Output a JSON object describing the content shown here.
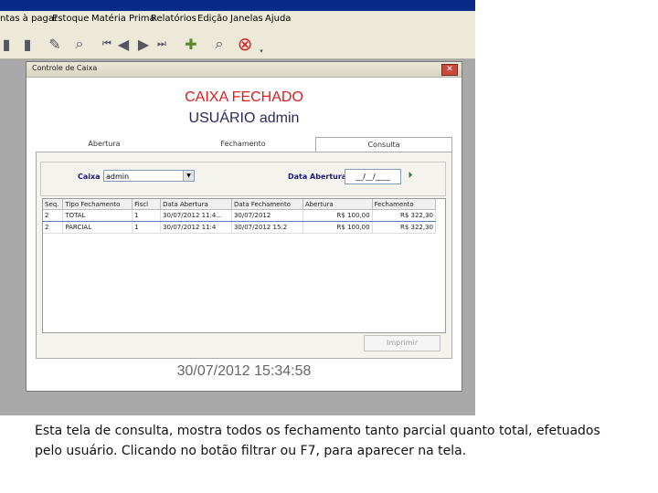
{
  "menu": {
    "items": [
      "ntas à pagar",
      "Estoque",
      "Matéria Prima",
      "Relatórios",
      "Edição",
      "Janelas",
      "Ajuda"
    ]
  },
  "window": {
    "title": "Controle de Caixa",
    "close_label": "✕"
  },
  "header": {
    "status": "CAIXA FECHADO",
    "user": "USUÁRIO admin"
  },
  "tabs": [
    "Abertura",
    "Fechamento",
    "Consulta"
  ],
  "filter": {
    "caixa_label": "Caixa",
    "caixa_value": "admin",
    "data_label": "Data Abertura",
    "data_value": "__/__/____"
  },
  "table": {
    "columns": [
      "Seq.",
      "Tipo Fechamento",
      "Fiscl",
      "Data Abertura",
      "Data Fechamento",
      "Abertura",
      "Fechamento"
    ],
    "rows": [
      [
        "2",
        "TOTAL",
        "1",
        "30/07/2012 11:4...",
        "30/07/2012",
        "R$ 100,00",
        "R$ 322,30"
      ],
      [
        "2",
        "PARCIAL",
        "1",
        "30/07/2012 11:4",
        "30/07/2012 15:2",
        "R$ 100,00",
        "R$ 322,30"
      ]
    ]
  },
  "buttons": {
    "imprimir": "Imprimir"
  },
  "clock": "30/07/2012 15:34:58",
  "caption": "Esta tela de consulta, mostra todos os fechamento tanto parcial quanto total, efetuados pelo usuário. Clicando no botão filtrar ou F7, para aparecer na tela.",
  "colors": {
    "status_red": "#e31b1b",
    "user_navy": "#2a2a5a"
  }
}
